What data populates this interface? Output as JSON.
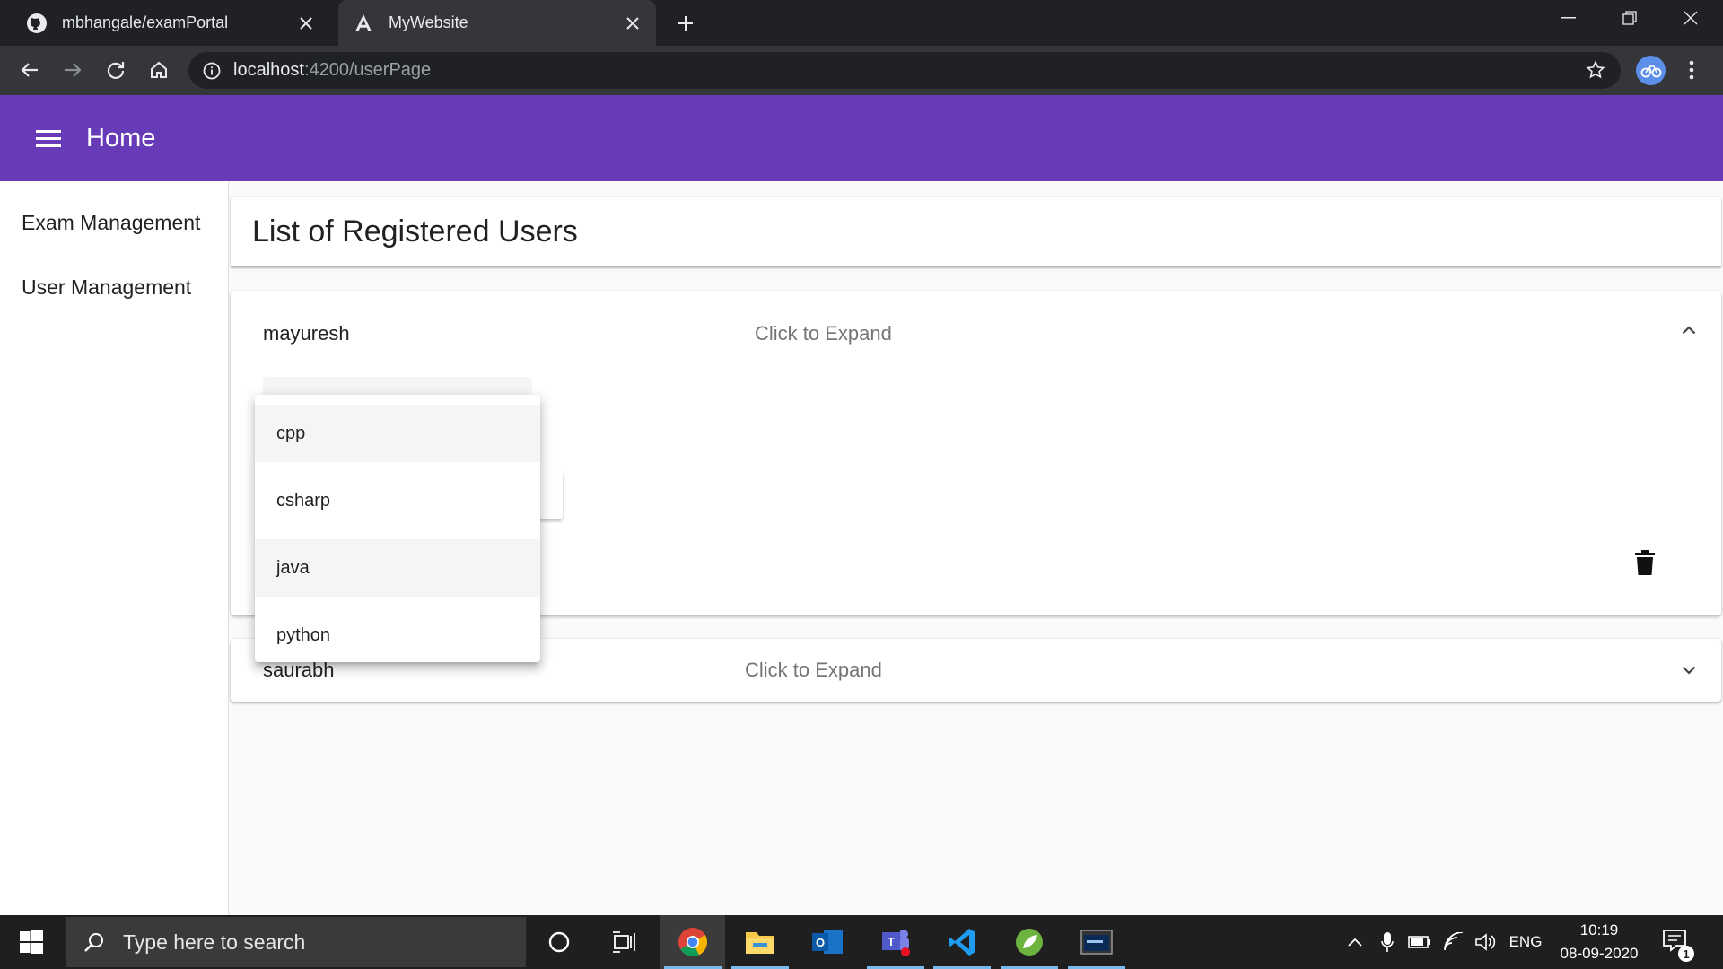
{
  "browser": {
    "tabs": [
      {
        "title": "mbhangale/examPortal",
        "icon": "github-icon"
      },
      {
        "title": "MyWebsite",
        "icon": "angular-icon"
      }
    ],
    "url_host": "localhost",
    "url_path": ":4200/userPage"
  },
  "app": {
    "title": "Home",
    "header_color": "#673ab7"
  },
  "sidenav": {
    "items": [
      {
        "label": "Exam Management"
      },
      {
        "label": "User Management"
      }
    ]
  },
  "main": {
    "heading": "List of Registered Users",
    "users": [
      {
        "name": "mayuresh",
        "description": "Click to Expand",
        "expanded": true
      },
      {
        "name": "saurabh",
        "description": "Click to Expand",
        "expanded": false
      }
    ]
  },
  "dropdown": {
    "options": [
      "cpp",
      "csharp",
      "java",
      "python"
    ],
    "highlighted": [
      "cpp",
      "java"
    ]
  },
  "taskbar": {
    "search_placeholder": "Type here to search",
    "language": "ENG",
    "time": "10:19",
    "date": "08-09-2020",
    "notification_count": "1"
  }
}
